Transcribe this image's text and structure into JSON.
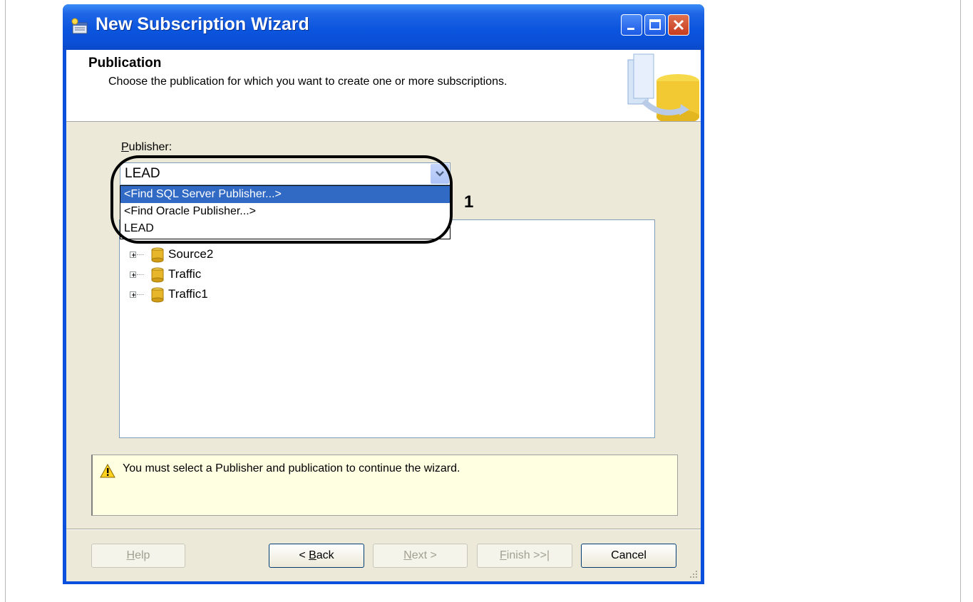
{
  "window": {
    "title": "New Subscription Wizard"
  },
  "header": {
    "heading": "Publication",
    "description": "Choose the publication for which you want to create one or more subscriptions."
  },
  "publisher": {
    "label_accel": "P",
    "label_rest": "ublisher:",
    "selected": "LEAD",
    "options": [
      "<Find SQL Server Publisher...>",
      "<Find Oracle Publisher...>",
      "LEAD"
    ],
    "highlighted_option": "<Find SQL Server Publisher...>"
  },
  "tree": {
    "items": [
      {
        "label": "Source2",
        "icon": "database-icon"
      },
      {
        "label": "Traffic",
        "icon": "database-icon"
      },
      {
        "label": "Traffic1",
        "icon": "database-icon"
      }
    ]
  },
  "annotation": {
    "number": "1"
  },
  "message": {
    "icon": "warning-icon",
    "text": "You must select a Publisher and publication to continue the wizard."
  },
  "buttons": {
    "help": {
      "accel": "H",
      "rest": "elp",
      "enabled": false
    },
    "back": {
      "pre": "< ",
      "accel": "B",
      "rest": "ack",
      "enabled": true
    },
    "next": {
      "accel": "N",
      "rest": "ext >",
      "enabled": false
    },
    "finish": {
      "accel": "F",
      "rest": "inish >>|",
      "enabled": false
    },
    "cancel": {
      "label": "Cancel",
      "enabled": true
    }
  },
  "colors": {
    "titlebar": "#0a50dc",
    "dialog_face": "#ece9d8",
    "selection": "#316ac5",
    "message_bg": "#ffffe1"
  }
}
